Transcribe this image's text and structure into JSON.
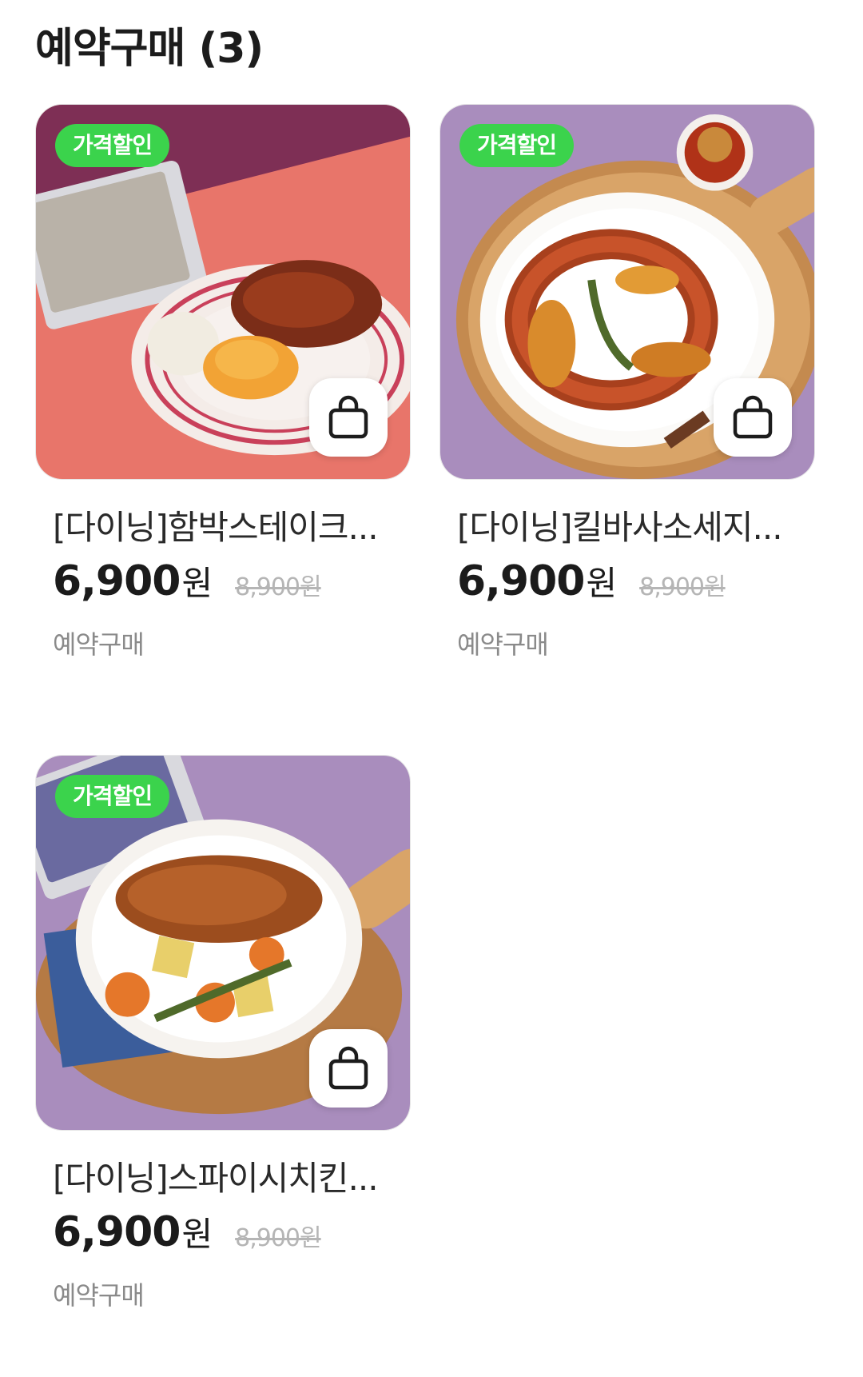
{
  "page": {
    "title": "예약구매 (3)"
  },
  "colors": {
    "badge": "#3bd34c",
    "text": "#1b1b1b",
    "muted": "#8a8a8a",
    "strike": "#b5b5b5"
  },
  "products": [
    {
      "name": "[다이닝]함박스테이크...",
      "badge": "가격할인",
      "price": "6,900",
      "currency": "원",
      "original_price": "8,900원",
      "sale_type": "예약구매",
      "image": "hamburg-steak-plate",
      "cart_icon": "shopping-bag-icon"
    },
    {
      "name": "[다이닝]킬바사소세지...",
      "badge": "가격할인",
      "price": "6,900",
      "currency": "원",
      "original_price": "8,900원",
      "sale_type": "예약구매",
      "image": "kielbasa-sausage-plate",
      "cart_icon": "shopping-bag-icon"
    },
    {
      "name": "[다이닝]스파이시치킨...",
      "badge": "가격할인",
      "price": "6,900",
      "currency": "원",
      "original_price": "8,900원",
      "sale_type": "예약구매",
      "image": "spicy-chicken-plate",
      "cart_icon": "shopping-bag-icon"
    }
  ]
}
